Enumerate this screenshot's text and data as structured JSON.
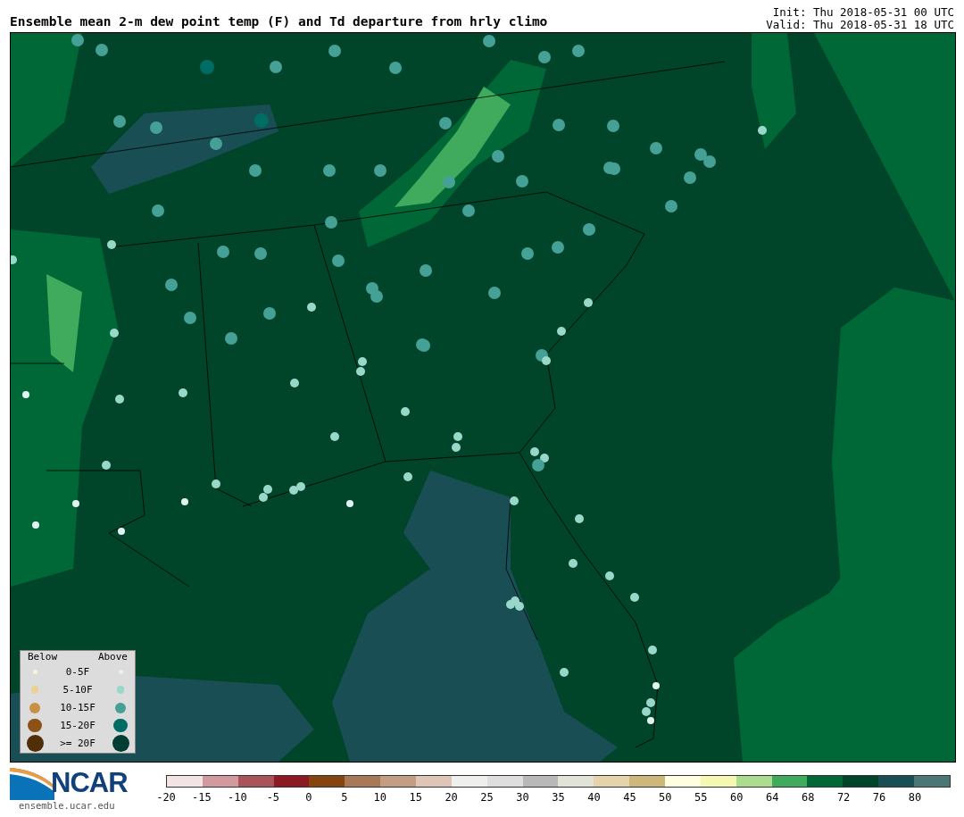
{
  "title": "Ensemble mean 2-m dew point temp (F) and Td departure from hrly climo",
  "init": "Init: Thu 2018-05-31 00 UTC",
  "valid": "Valid: Thu 2018-05-31 18 UTC",
  "legend": {
    "below_header": "Below",
    "above_header": "Above",
    "rows": [
      {
        "label": "0-5F",
        "below": {
          "color": "#fdf1dc"
        },
        "above": {
          "color": "#e0f3f0"
        }
      },
      {
        "label": "5-10F",
        "below": {
          "color": "#ecd194"
        },
        "above": {
          "color": "#99d8c9"
        }
      },
      {
        "label": "10-15F",
        "below": {
          "color": "#c98f44"
        },
        "above": {
          "color": "#45a195"
        }
      },
      {
        "label": "15-20F",
        "below": {
          "color": "#8c5215"
        },
        "above": {
          "color": "#006d64"
        }
      },
      {
        "label": ">= 20F",
        "below": {
          "color": "#4f2e08"
        },
        "above": {
          "color": "#003d33"
        }
      }
    ]
  },
  "logo": {
    "name": "NCAR",
    "url": "ensemble.ucar.edu"
  },
  "colorbar": {
    "bins": [
      {
        "color": "#f3e4e4"
      },
      {
        "color": "#d09a9f"
      },
      {
        "color": "#a8545a"
      },
      {
        "color": "#8b1a22"
      },
      {
        "color": "#86440f"
      },
      {
        "color": "#a87957"
      },
      {
        "color": "#c49e83"
      },
      {
        "color": "#dfc5b5"
      },
      {
        "color": "#efefee"
      },
      {
        "color": "#dedede"
      },
      {
        "color": "#b8b8b8"
      },
      {
        "color": "#e1e3d6"
      },
      {
        "color": "#e4d3ab"
      },
      {
        "color": "#cdb77b"
      },
      {
        "color": "#fffee0"
      },
      {
        "color": "#f5f8b0"
      },
      {
        "color": "#acdd8e"
      },
      {
        "color": "#41ab5d"
      },
      {
        "color": "#006837"
      },
      {
        "color": "#00452a"
      },
      {
        "color": "#1a4e55"
      },
      {
        "color": "#4a7676"
      }
    ],
    "ticks": [
      "-20",
      "-15",
      "-10",
      "-5",
      "0",
      "5",
      "10",
      "15",
      "20",
      "25",
      "30",
      "35",
      "40",
      "45",
      "50",
      "55",
      "60",
      "64",
      "68",
      "72",
      "76",
      "80"
    ]
  }
}
